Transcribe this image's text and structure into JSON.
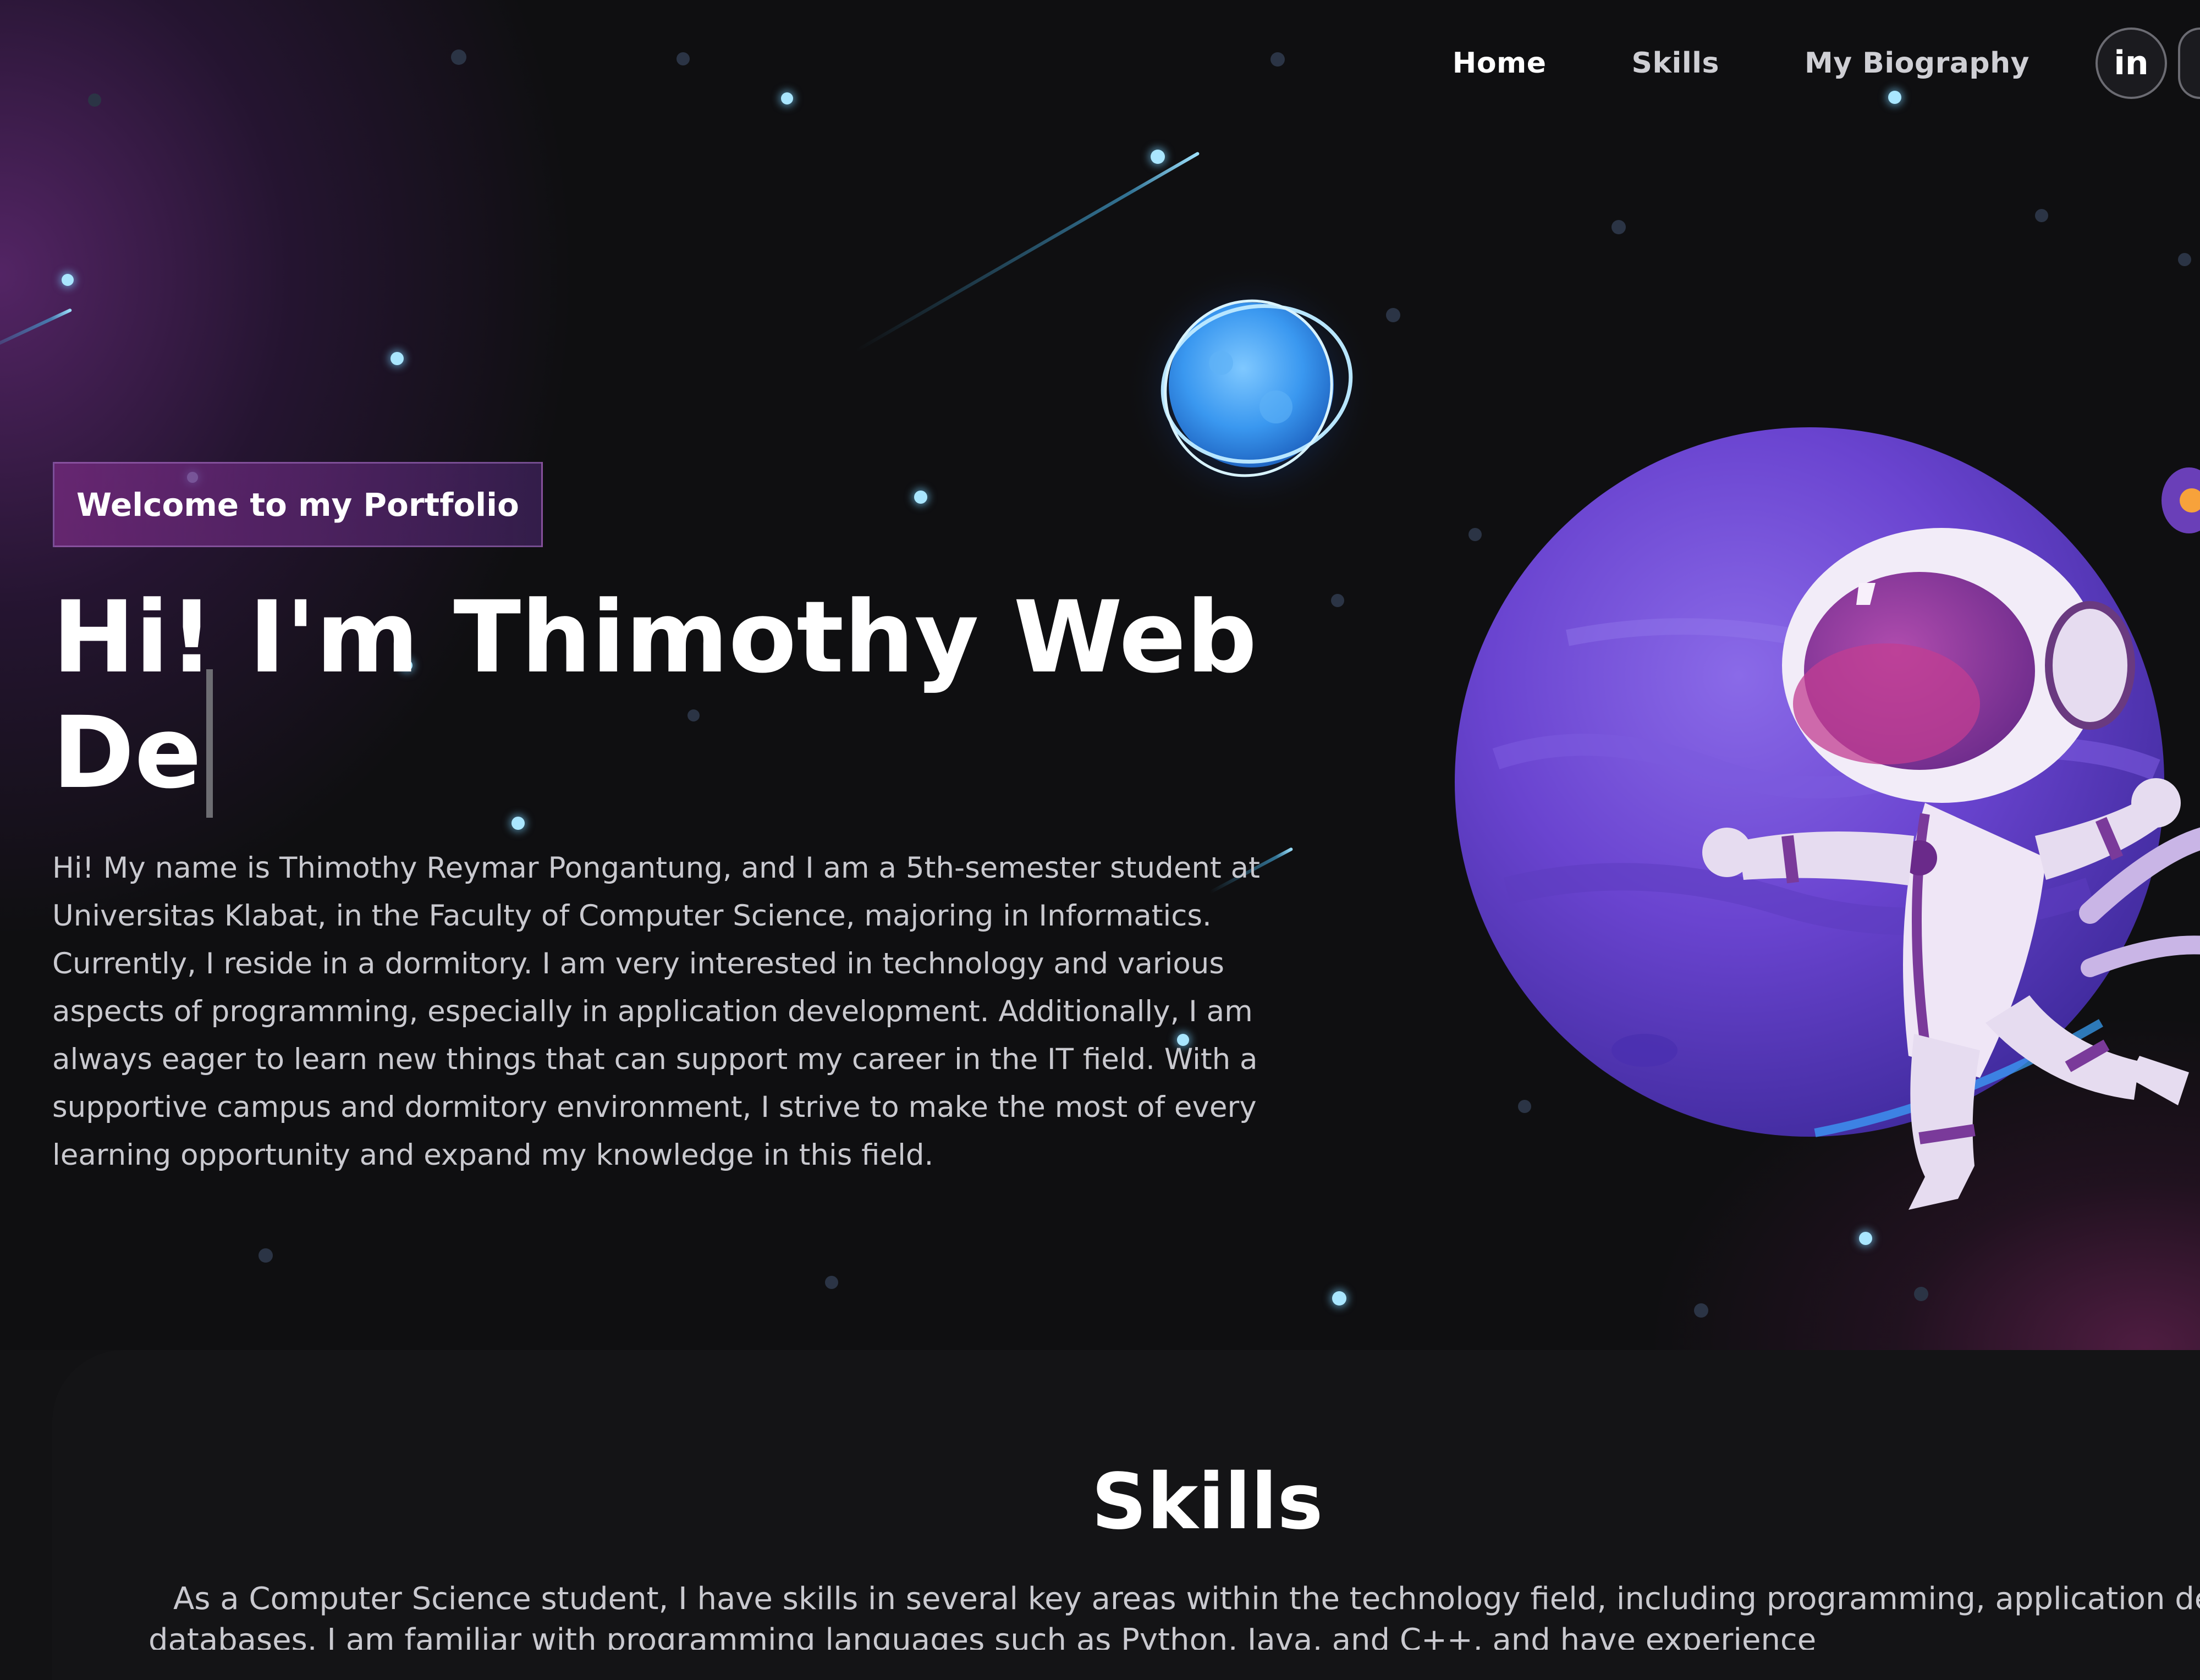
{
  "nav": {
    "items": [
      {
        "label": "Home",
        "active": true
      },
      {
        "label": "Skills",
        "active": false
      },
      {
        "label": "My Biography",
        "active": false
      }
    ],
    "social": [
      {
        "label": "in",
        "icon": "linkedin-icon"
      },
      {
        "label": "",
        "icon": "social-icon"
      }
    ]
  },
  "hero": {
    "tagline": "Welcome to my Portfolio",
    "headline_line1": "Hi! I'm Thimothy Web",
    "headline_line2": "De",
    "intro": "Hi! My name is Thimothy Reymar Pongantung, and I am a 5th-semester student at Universitas Klabat, in the Faculty of Computer Science, majoring in Informatics. Currently, I reside in a dormitory. I am very interested in technology and various aspects of programming, especially in application development. Additionally, I am always eager to learn new things that can support my career in the IT field. With a supportive campus and dormitory environment, I strive to make the most of every learning opportunity and expand my knowledge in this field."
  },
  "skills": {
    "title": "Skills",
    "text": "As a Computer Science student, I have skills in several key areas within the technology field, including programming, application development, and databases. I am familiar with programming languages such as Python, Java, and C++, and have experience"
  },
  "colors": {
    "background": "#121214",
    "accent_purple": "#6a3fd1",
    "tagline_bg": "#6e2878",
    "star_cyan": "#a9e6ff"
  },
  "illustration": {
    "subject": "astronaut-floating-by-purple-planet"
  }
}
